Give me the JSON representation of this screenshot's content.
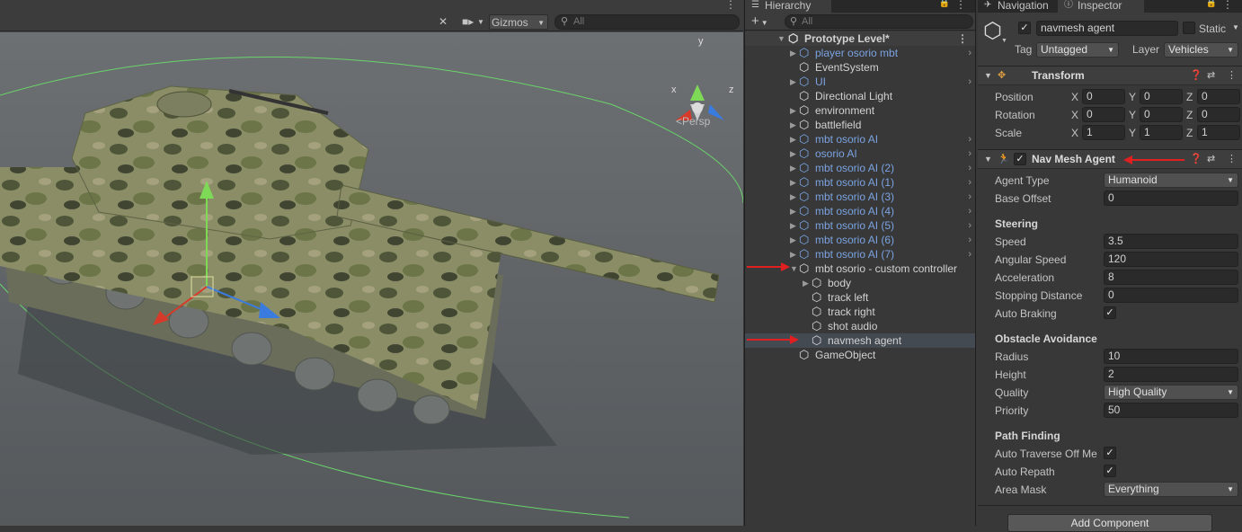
{
  "scene": {
    "gizmos_label": "Gizmos",
    "search_placeholder": "All",
    "projection_label": "<Persp",
    "axis_x": "x",
    "axis_y": "y",
    "axis_z": "z",
    "colors": {
      "x_axis": "#d63a2a",
      "y_axis": "#7ed957",
      "z_axis": "#3a7be0",
      "bounds": "#6ad46a"
    }
  },
  "hierarchy": {
    "tab_label": "Hierarchy",
    "search_placeholder": "All",
    "scene_name": "Prototype Level*",
    "items": [
      {
        "label": "player osorio mbt",
        "prefab": true,
        "depth": 1,
        "expandable": true
      },
      {
        "label": "EventSystem",
        "prefab": false,
        "depth": 1,
        "expandable": false
      },
      {
        "label": "UI",
        "prefab": true,
        "depth": 1,
        "expandable": true
      },
      {
        "label": "Directional Light",
        "prefab": false,
        "depth": 1,
        "expandable": false
      },
      {
        "label": "environment",
        "prefab": false,
        "depth": 1,
        "expandable": true
      },
      {
        "label": "battlefield",
        "prefab": false,
        "depth": 1,
        "expandable": true
      },
      {
        "label": "mbt osorio AI",
        "prefab": true,
        "depth": 1,
        "expandable": true
      },
      {
        "label": "osorio AI",
        "prefab": true,
        "depth": 1,
        "expandable": true
      },
      {
        "label": "mbt osorio AI (2)",
        "prefab": true,
        "depth": 1,
        "expandable": true
      },
      {
        "label": "mbt osorio AI (1)",
        "prefab": true,
        "depth": 1,
        "expandable": true
      },
      {
        "label": "mbt osorio AI (3)",
        "prefab": true,
        "depth": 1,
        "expandable": true
      },
      {
        "label": "mbt osorio AI (4)",
        "prefab": true,
        "depth": 1,
        "expandable": true
      },
      {
        "label": "mbt osorio AI (5)",
        "prefab": true,
        "depth": 1,
        "expandable": true
      },
      {
        "label": "mbt osorio AI (6)",
        "prefab": true,
        "depth": 1,
        "expandable": true
      },
      {
        "label": "mbt osorio AI (7)",
        "prefab": true,
        "depth": 1,
        "expandable": true
      },
      {
        "label": "mbt osorio - custom controller",
        "prefab": false,
        "depth": 1,
        "expanded": true
      },
      {
        "label": "body",
        "prefab": false,
        "depth": 2,
        "expandable": true
      },
      {
        "label": "track left",
        "prefab": false,
        "depth": 2,
        "expandable": false
      },
      {
        "label": "track right",
        "prefab": false,
        "depth": 2,
        "expandable": false
      },
      {
        "label": "shot audio",
        "prefab": false,
        "depth": 2,
        "expandable": false
      },
      {
        "label": "navmesh agent",
        "prefab": false,
        "depth": 2,
        "expandable": false,
        "selected": true
      },
      {
        "label": "GameObject",
        "prefab": false,
        "depth": 1,
        "expandable": false
      }
    ]
  },
  "inspector": {
    "tabs": {
      "navigation": "Navigation",
      "inspector": "Inspector"
    },
    "object_name": "navmesh agent",
    "static_label": "Static",
    "tag_label": "Tag",
    "tag_value": "Untagged",
    "layer_label": "Layer",
    "layer_value": "Vehicles",
    "transform": {
      "title": "Transform",
      "position_label": "Position",
      "rotation_label": "Rotation",
      "scale_label": "Scale",
      "x": "X",
      "y": "Y",
      "z": "Z",
      "position": [
        "0",
        "0",
        "0"
      ],
      "rotation": [
        "0",
        "0",
        "0"
      ],
      "scale": [
        "1",
        "1",
        "1"
      ]
    },
    "nav_mesh_agent": {
      "title": "Nav Mesh Agent",
      "agent_type_label": "Agent Type",
      "agent_type_value": "Humanoid",
      "base_offset_label": "Base Offset",
      "base_offset_value": "0",
      "steering_title": "Steering",
      "speed_label": "Speed",
      "speed_value": "3.5",
      "angular_speed_label": "Angular Speed",
      "angular_speed_value": "120",
      "acceleration_label": "Acceleration",
      "acceleration_value": "8",
      "stopping_distance_label": "Stopping Distance",
      "stopping_distance_value": "0",
      "auto_braking_label": "Auto Braking",
      "obstacle_title": "Obstacle Avoidance",
      "radius_label": "Radius",
      "radius_value": "10",
      "height_label": "Height",
      "height_value": "2",
      "quality_label": "Quality",
      "quality_value": "High Quality",
      "priority_label": "Priority",
      "priority_value": "50",
      "path_title": "Path Finding",
      "auto_traverse_label": "Auto Traverse Off Me",
      "auto_repath_label": "Auto Repath",
      "area_mask_label": "Area Mask",
      "area_mask_value": "Everything"
    },
    "add_component_label": "Add Component"
  }
}
